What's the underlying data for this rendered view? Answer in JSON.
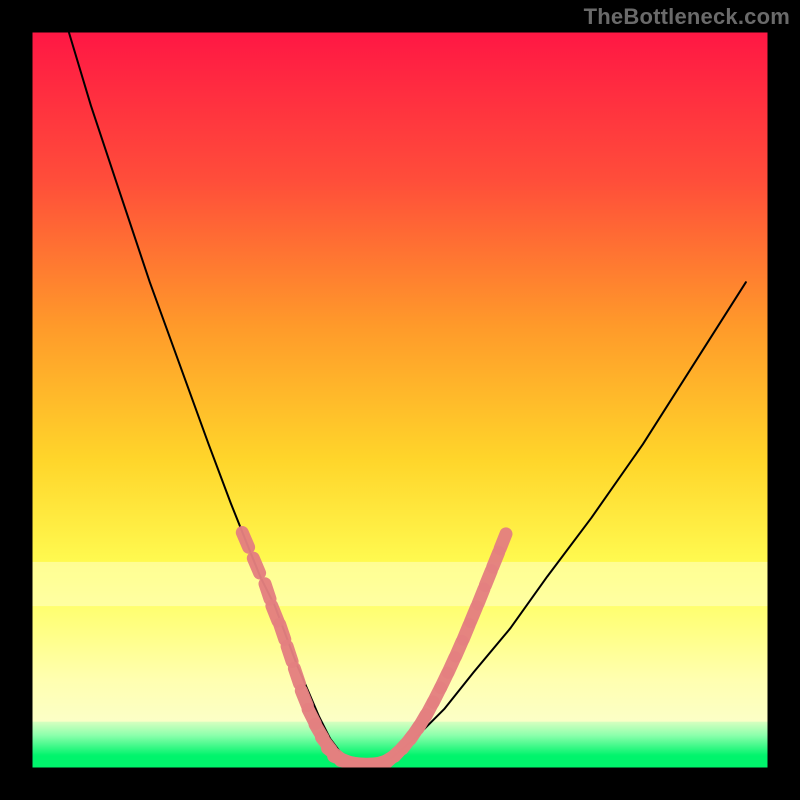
{
  "watermark": "TheBottleneck.com",
  "colors": {
    "frame": "#000000",
    "curve": "#000000",
    "marker_fill": "#e48080",
    "marker_stroke": "#c46060",
    "green_band": "#00f46c",
    "gradient_top": "#ff1744",
    "gradient_mid1": "#ff7a2a",
    "gradient_mid2": "#ffd52a",
    "gradient_mid3": "#ffff66",
    "gradient_bottom": "#f7ffd0"
  },
  "chart_data": {
    "type": "line",
    "title": "",
    "xlabel": "",
    "ylabel": "",
    "xlim": [
      0,
      100
    ],
    "ylim": [
      0,
      100
    ],
    "series": [
      {
        "name": "bottleneck-curve",
        "x": [
          5,
          8,
          12,
          16,
          20,
          24,
          27,
          29,
          31,
          33,
          34.5,
          36,
          37.5,
          39,
          40.5,
          42,
          43.5,
          45,
          47,
          49,
          52,
          56,
          60,
          65,
          70,
          76,
          83,
          90,
          97
        ],
        "y": [
          100,
          90,
          78,
          66,
          55,
          44,
          36,
          31,
          26,
          22,
          18,
          14,
          10.5,
          7,
          4,
          2,
          1,
          0.5,
          0.5,
          1.5,
          4,
          8,
          13,
          19,
          26,
          34,
          44,
          55,
          66
        ]
      }
    ],
    "markers": {
      "name": "highlighted-range",
      "points": [
        {
          "x": 29.0,
          "y": 31.0
        },
        {
          "x": 30.5,
          "y": 27.5
        },
        {
          "x": 32.0,
          "y": 24.0
        },
        {
          "x": 33.0,
          "y": 21.0
        },
        {
          "x": 34.0,
          "y": 18.5
        },
        {
          "x": 35.0,
          "y": 15.5
        },
        {
          "x": 36.0,
          "y": 12.5
        },
        {
          "x": 37.0,
          "y": 9.5
        },
        {
          "x": 38.0,
          "y": 7.0
        },
        {
          "x": 39.0,
          "y": 5.0
        },
        {
          "x": 40.0,
          "y": 3.3
        },
        {
          "x": 41.0,
          "y": 2.0
        },
        {
          "x": 42.0,
          "y": 1.2
        },
        {
          "x": 43.0,
          "y": 0.8
        },
        {
          "x": 44.0,
          "y": 0.6
        },
        {
          "x": 45.0,
          "y": 0.5
        },
        {
          "x": 46.0,
          "y": 0.5
        },
        {
          "x": 47.0,
          "y": 0.6
        },
        {
          "x": 48.0,
          "y": 0.9
        },
        {
          "x": 49.0,
          "y": 1.5
        },
        {
          "x": 50.0,
          "y": 2.4
        },
        {
          "x": 51.0,
          "y": 3.5
        },
        {
          "x": 52.0,
          "y": 4.8
        },
        {
          "x": 53.0,
          "y": 6.3
        },
        {
          "x": 54.0,
          "y": 8.0
        },
        {
          "x": 55.0,
          "y": 9.9
        },
        {
          "x": 56.0,
          "y": 11.9
        },
        {
          "x": 57.0,
          "y": 14.0
        },
        {
          "x": 58.0,
          "y": 16.2
        },
        {
          "x": 59.0,
          "y": 18.5
        },
        {
          "x": 60.0,
          "y": 20.9
        },
        {
          "x": 61.0,
          "y": 23.3
        },
        {
          "x": 62.0,
          "y": 25.8
        },
        {
          "x": 63.0,
          "y": 28.3
        },
        {
          "x": 64.0,
          "y": 30.8
        }
      ]
    },
    "bands": [
      {
        "name": "pale-yellow",
        "y0": 22,
        "y1": 28,
        "color": "#fcffb0"
      },
      {
        "name": "green-grad",
        "y0": 1.7,
        "y1": 6.3,
        "color": "linear"
      },
      {
        "name": "green-solid",
        "y0": 0,
        "y1": 1.7,
        "color": "#00f46c"
      }
    ]
  }
}
